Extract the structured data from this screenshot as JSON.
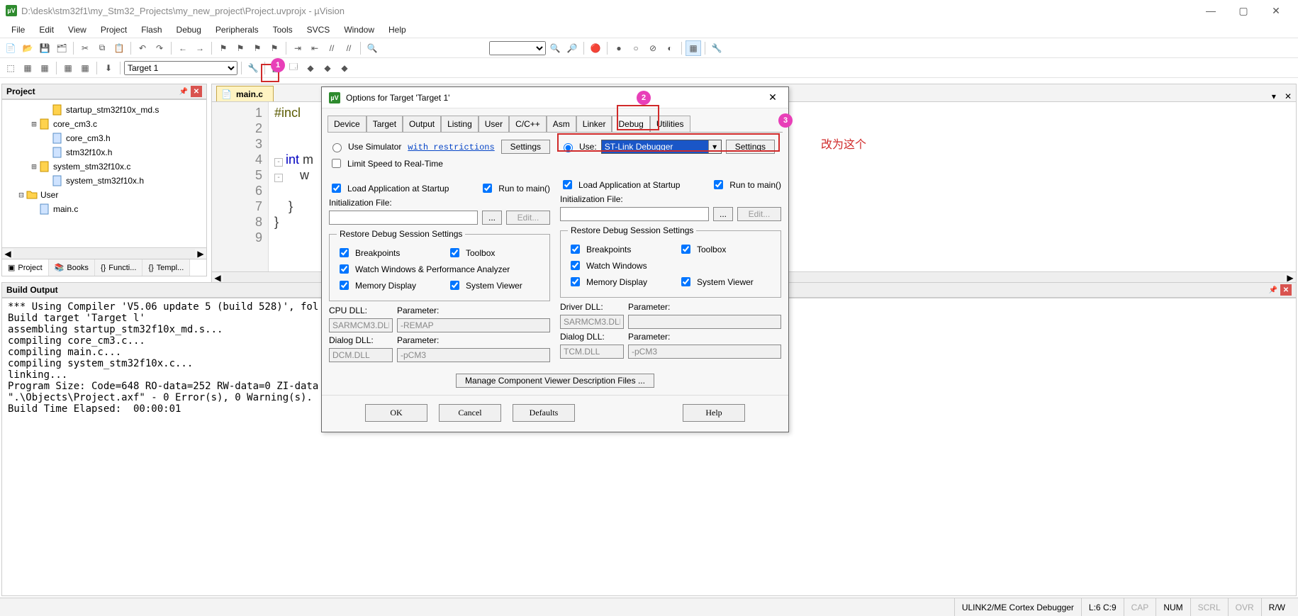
{
  "window": {
    "title": "D:\\desk\\stm32f1\\my_Stm32_Projects\\my_new_project\\Project.uvprojx - µVision"
  },
  "menu": [
    "File",
    "Edit",
    "View",
    "Project",
    "Flash",
    "Debug",
    "Peripherals",
    "Tools",
    "SVCS",
    "Window",
    "Help"
  ],
  "toolbar2": {
    "target": "Target 1"
  },
  "project_panel": {
    "title": "Project",
    "tree": [
      {
        "indent": 3,
        "icon": "yellow",
        "label": "startup_stm32f10x_md.s",
        "exp": ""
      },
      {
        "indent": 2,
        "icon": "yellow",
        "label": "core_cm3.c",
        "exp": "+"
      },
      {
        "indent": 3,
        "icon": "blue",
        "label": "core_cm3.h",
        "exp": ""
      },
      {
        "indent": 3,
        "icon": "blue",
        "label": "stm32f10x.h",
        "exp": ""
      },
      {
        "indent": 2,
        "icon": "yellow",
        "label": "system_stm32f10x.c",
        "exp": "+"
      },
      {
        "indent": 3,
        "icon": "blue",
        "label": "system_stm32f10x.h",
        "exp": ""
      },
      {
        "indent": 1,
        "icon": "folder",
        "label": "User",
        "exp": "-"
      },
      {
        "indent": 2,
        "icon": "blue",
        "label": "main.c",
        "exp": ""
      }
    ],
    "tabs": [
      "Project",
      "Books",
      "Functi...",
      "Templ..."
    ]
  },
  "editor": {
    "tab_label": "main.c",
    "lines": [
      {
        "n": "1",
        "html": "<span class='kw-pre'>#incl</span>"
      },
      {
        "n": "2",
        "html": ""
      },
      {
        "n": "3",
        "html": ""
      },
      {
        "n": "4",
        "html": "<span class='kw-type'>int</span> m",
        "fold": "-"
      },
      {
        "n": "5",
        "html": "    w",
        "fold": "-"
      },
      {
        "n": "6",
        "html": ""
      },
      {
        "n": "7",
        "html": "    }"
      },
      {
        "n": "8",
        "html": "}"
      },
      {
        "n": "9",
        "html": ""
      }
    ]
  },
  "build_output": {
    "title": "Build Output",
    "text": "*** Using Compiler 'V5.06 update 5 (build 528)', fol\nBuild target 'Target l'\nassembling startup_stm32f10x_md.s...\ncompiling core_cm3.c...\ncompiling main.c...\ncompiling system_stm32f10x.c...\nlinking...\nProgram Size: Code=648 RO-data=252 RW-data=0 ZI-data\n\".\\Objects\\Project.axf\" - 0 Error(s), 0 Warning(s).\nBuild Time Elapsed:  00:00:01\n"
  },
  "statusbar": {
    "debugger": "ULINK2/ME Cortex Debugger",
    "pos": "L:6 C:9",
    "caps": "CAP",
    "num": "NUM",
    "scrl": "SCRL",
    "ovr": "OVR",
    "rw": "R/W"
  },
  "dialog": {
    "title": "Options for Target 'Target 1'",
    "tabs": [
      "Device",
      "Target",
      "Output",
      "Listing",
      "User",
      "C/C++",
      "Asm",
      "Linker",
      "Debug",
      "Utilities"
    ],
    "active_tab": "Debug",
    "left": {
      "use_sim": "Use Simulator",
      "restrictions": "with restrictions",
      "settings": "Settings",
      "limit": "Limit Speed to Real-Time",
      "load_app": "Load Application at Startup",
      "run_main": "Run to main()",
      "init_file": "Initialization File:",
      "edit": "Edit...",
      "restore_legend": "Restore Debug Session Settings",
      "breakpoints": "Breakpoints",
      "toolbox": "Toolbox",
      "watchperf": "Watch Windows & Performance Analyzer",
      "memdisp": "Memory Display",
      "sysview": "System Viewer",
      "cpudll_lbl": "CPU DLL:",
      "cpudll": "SARMCM3.DLL",
      "param_lbl": "Parameter:",
      "cpuparam": "-REMAP",
      "dlgdll_lbl": "Dialog DLL:",
      "dlgdll": "DCM.DLL",
      "dlgparam": "-pCM3"
    },
    "right": {
      "use": "Use:",
      "debugger_sel": "ST-Link Debugger",
      "settings": "Settings",
      "load_app": "Load Application at Startup",
      "run_main": "Run to main()",
      "init_file": "Initialization File:",
      "edit": "Edit...",
      "restore_legend": "Restore Debug Session Settings",
      "breakpoints": "Breakpoints",
      "toolbox": "Toolbox",
      "watch": "Watch Windows",
      "memdisp": "Memory Display",
      "sysview": "System Viewer",
      "drvdll_lbl": "Driver DLL:",
      "drvdll": "SARMCM3.DLL",
      "drvparam": "",
      "dlgdll_lbl": "Dialog DLL:",
      "dlgdll": "TCM.DLL",
      "dlgparam": "-pCM3"
    },
    "manage_btn": "Manage Component Viewer Description Files ...",
    "footer": {
      "ok": "OK",
      "cancel": "Cancel",
      "defaults": "Defaults",
      "help": "Help"
    }
  },
  "annotations": {
    "text": "改为这个"
  }
}
